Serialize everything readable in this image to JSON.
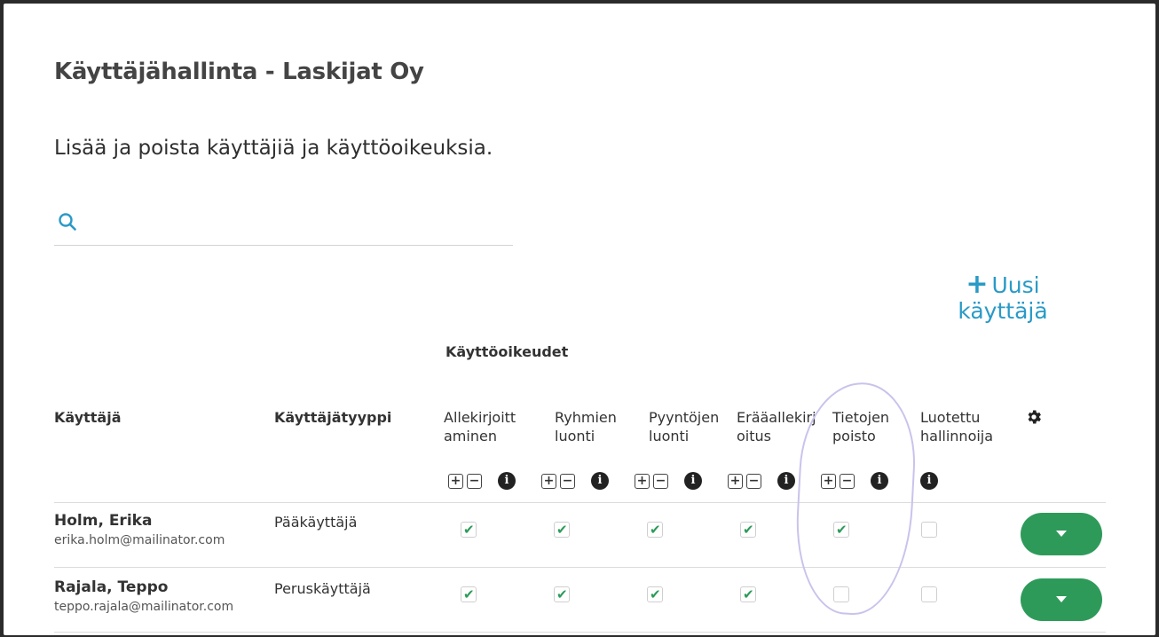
{
  "page": {
    "title": "Käyttäjähallinta - Laskijat Oy",
    "subtitle": "Lisää ja poista käyttäjiä ja käyttöoikeuksia."
  },
  "search": {
    "placeholder": "",
    "value": ""
  },
  "new_user_button": {
    "label": "Uusi käyttäjä",
    "label_line1": "Uusi",
    "label_line2": "käyttäjä",
    "icon": "plus-icon",
    "color": "#2a9ac6"
  },
  "permissions_group_label": "Käyttöoikeudet",
  "columns": {
    "user": "Käyttäjä",
    "user_type": "Käyttäjätyyppi",
    "permissions": [
      {
        "line1": "Allekirjoitt",
        "line2": "aminen"
      },
      {
        "line1": "Ryhmien",
        "line2": "luonti"
      },
      {
        "line1": "Pyyntöjen",
        "line2": "luonti"
      },
      {
        "line1": "Erääallekirj",
        "line2": "oitus"
      },
      {
        "line1": "Tietojen",
        "line2": "poisto"
      },
      {
        "line1": "Luotettu",
        "line2": "hallinnoija"
      }
    ],
    "settings_icon": "gear-icon"
  },
  "column_controls": {
    "add": "+",
    "remove": "−",
    "info": "i"
  },
  "users": [
    {
      "name": "Holm, Erika",
      "email": "erika.holm@mailinator.com",
      "type": "Pääkäyttäjä",
      "permissions": [
        true,
        true,
        true,
        true,
        true,
        false
      ]
    },
    {
      "name": "Rajala, Teppo",
      "email": "teppo.rajala@mailinator.com",
      "type": "Peruskäyttäjä",
      "permissions": [
        true,
        true,
        true,
        true,
        false,
        false
      ]
    }
  ],
  "colors": {
    "accent": "#2a9ac6",
    "action_button": "#2e9a5a",
    "check": "#2b9b58",
    "annotation": "#c9c3ec"
  }
}
